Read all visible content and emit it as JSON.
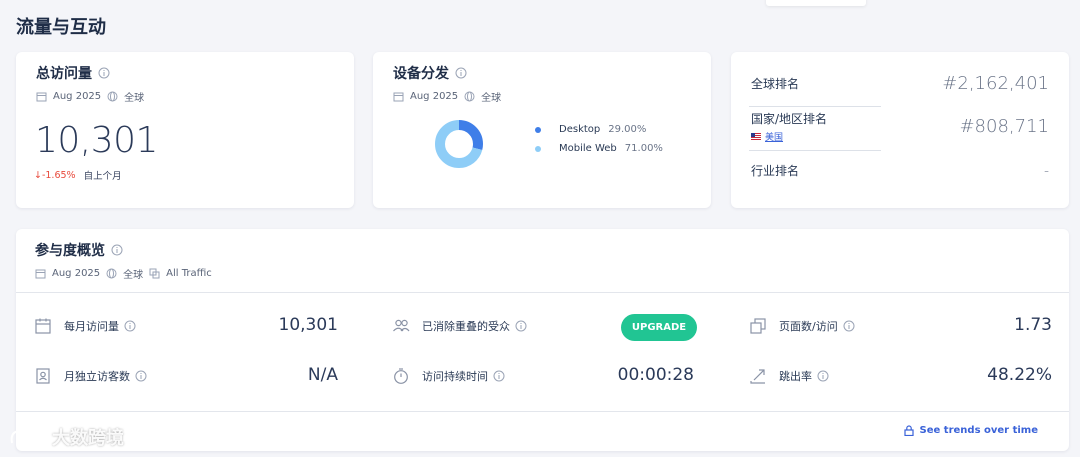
{
  "page": {
    "title": "流量与互动"
  },
  "total_visits": {
    "title": "总访问量",
    "period": "Aug 2025",
    "region": "全球",
    "value": "10,301",
    "change": "↓-1.65%",
    "change_note": "自上个月"
  },
  "device": {
    "title": "设备分发",
    "period": "Aug 2025",
    "region": "全球",
    "items": [
      {
        "label": "Desktop",
        "pct": "29.00%",
        "value": 29.0,
        "color": "#3f7ee8"
      },
      {
        "label": "Mobile Web",
        "pct": "71.00%",
        "value": 71.0,
        "color": "#8ecdf7"
      }
    ]
  },
  "ranks": {
    "global_label": "全球排名",
    "global_value": "#2,162,401",
    "country_label": "国家/地区排名",
    "country_name": "美国",
    "country_value": "#808,711",
    "industry_label": "行业排名",
    "industry_value": "-"
  },
  "engagement": {
    "title": "参与度概览",
    "period": "Aug 2025",
    "region": "全球",
    "traffic": "All Traffic",
    "monthly_visits_label": "每月访问量",
    "monthly_visits_value": "10,301",
    "unique_visitors_label": "月独立访客数",
    "unique_visitors_value": "N/A",
    "dedup_audience_label": "已消除重叠的受众",
    "upgrade_label": "UPGRADE",
    "visit_duration_label": "访问持续时间",
    "visit_duration_value": "00:00:28",
    "pages_per_visit_label": "页面数/访问",
    "pages_per_visit_value": "1.73",
    "bounce_rate_label": "跳出率",
    "bounce_rate_value": "48.22%",
    "trends_link": "See trends over time"
  },
  "watermark": {
    "text": "大数跨境"
  }
}
